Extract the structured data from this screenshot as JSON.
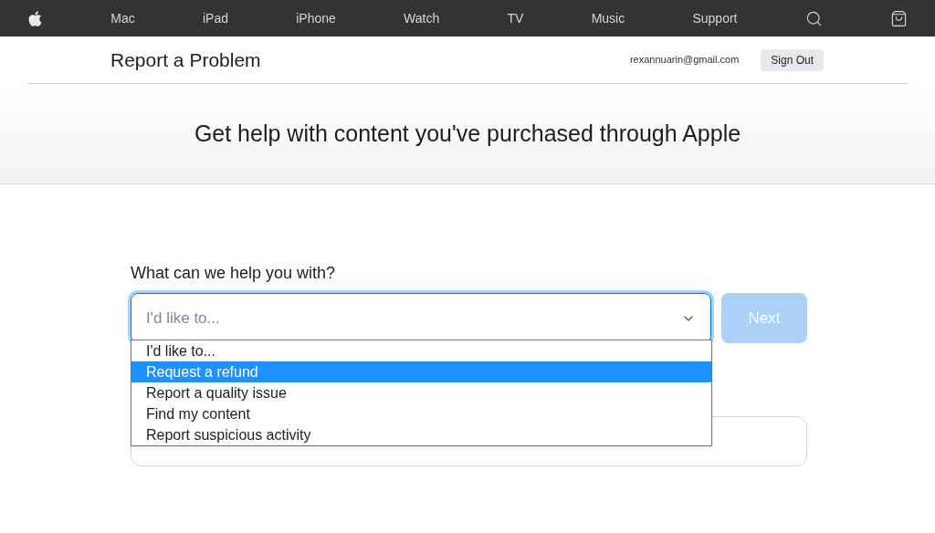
{
  "nav": {
    "items": [
      "Mac",
      "iPad",
      "iPhone",
      "Watch",
      "TV",
      "Music",
      "Support"
    ]
  },
  "header": {
    "title": "Report a Problem",
    "email": "rexannuarin@gmail.com",
    "sign_out": "Sign Out"
  },
  "hero": {
    "heading": "Get help with content you've purchased through Apple"
  },
  "form": {
    "label": "What can we help you with?",
    "select": {
      "placeholder": "I'd like to...",
      "expanded": true,
      "options": [
        {
          "label": "I'd like to...",
          "selected": false
        },
        {
          "label": "Request a refund",
          "selected": true
        },
        {
          "label": "Report a quality issue",
          "selected": false
        },
        {
          "label": "Find my content",
          "selected": false
        },
        {
          "label": "Report suspicious activity",
          "selected": false
        }
      ]
    },
    "next": {
      "label": "Next",
      "disabled": true
    }
  }
}
